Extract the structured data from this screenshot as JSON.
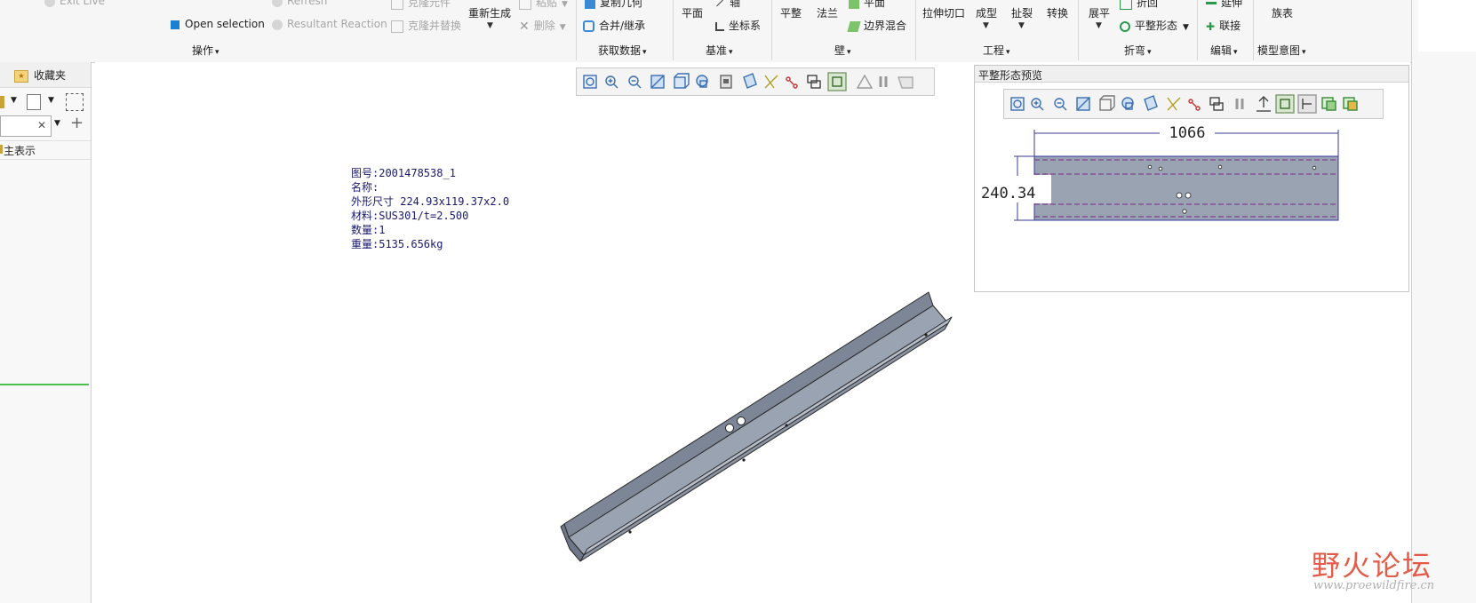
{
  "ribbon": {
    "operations": {
      "exit_live": "Exit Live",
      "refresh": "Refresh",
      "clone_element": "克隆元件",
      "open_selection": "Open selection",
      "resultant_reaction": "Resultant Reaction",
      "clone_and_replace": "克隆并替换",
      "regenerate": "重新生成",
      "paste": "粘贴",
      "delete": "删除",
      "group_label": "操作"
    },
    "get_data": {
      "copy_geometry": "复制几何",
      "merge_inherit": "合并/继承",
      "group_label": "获取数据"
    },
    "datum": {
      "plane": "平面",
      "axis": "轴",
      "csys": "坐标系",
      "group_label": "基准"
    },
    "wall": {
      "flat": "平整",
      "flange": "法兰",
      "planar": "平面",
      "boundary_blend": "边界混合",
      "group_label": "壁"
    },
    "engineering": {
      "extrude_cut": "拉伸切口",
      "form": "成型",
      "rip": "扯裂",
      "convert": "转换",
      "group_label": "工程"
    },
    "bend": {
      "unbend": "展平",
      "bend_back": "折回",
      "flat_state": "平整形态",
      "group_label": "折弯"
    },
    "edit": {
      "extend": "延伸",
      "join": "联接",
      "group_label": "编辑"
    },
    "model_intent": {
      "family_table": "族表",
      "group_label": "模型意图"
    }
  },
  "left_panel": {
    "favorites": "收藏夹",
    "tree_item": "主表示"
  },
  "annotation": {
    "drawing_no": "图号:2001478538_1",
    "name": "名称:",
    "dimensions": "外形尺寸 224.93x119.37x2.0",
    "material": "材料:SUS301/t=2.500",
    "quantity": "数量:1",
    "weight": "重量:5135.656kg"
  },
  "preview": {
    "title": "平整形态预览",
    "width_dim": "1066",
    "height_dim": "240.34"
  },
  "watermark": {
    "brand": "野火论坛",
    "url": "www.proewildfire.cn"
  },
  "colors": {
    "part_fill": "#9aa3b2",
    "part_edge": "#2a2a2a",
    "annotation_text": "#1a1a6e",
    "dim_line": "#3a3a9a",
    "preview_edge": "#7a2a8a",
    "watermark_red": "#e0402a"
  }
}
